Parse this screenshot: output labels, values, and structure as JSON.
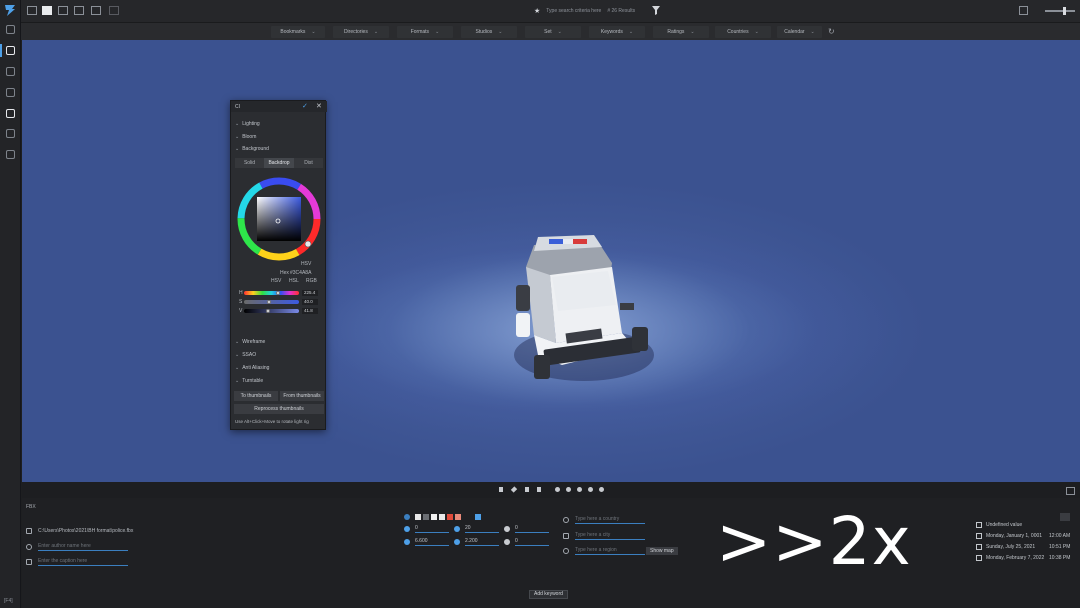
{
  "topbar": {
    "search_placeholder": "Type search criteria here",
    "result_count": "# 26 Results"
  },
  "filterbar": {
    "items": [
      "Bookmarks",
      "Directories",
      "Formats",
      "Studios",
      "Set",
      "Keywords",
      "Ratings",
      "Countries",
      "Calendar"
    ]
  },
  "panel": {
    "title": "CI",
    "sections_top": [
      "Lighting",
      "Bloom",
      "Background"
    ],
    "bg_modes": [
      "Solid",
      "Backdrop",
      "Dist"
    ],
    "active_bg_mode": "Backdrop",
    "color_mode": "HSV",
    "hex_label": "Hex",
    "hex_value": "#3C4A8A",
    "modes": [
      "HSV",
      "HSL",
      "RGB"
    ],
    "sliders": [
      {
        "label": "H",
        "value": "225.4",
        "pos": 0.63
      },
      {
        "label": "S",
        "value": "40.0",
        "pos": 0.45
      },
      {
        "label": "V",
        "value": "41.8",
        "pos": 0.43
      }
    ],
    "sections_bottom": [
      "Wireframe",
      "SSAO",
      "Anti Aliasing",
      "Turntable"
    ],
    "btn_to_thumbs": "To thumbnails",
    "btn_from_thumbs": "From thumbnails",
    "btn_reprocess": "Reprocess thumbnails",
    "hint": "Use Alt+Click+Move to rotate light rig"
  },
  "bottom": {
    "file_ext": "FBX",
    "path": "C:\\Users\\Photos\\2021\\BH format\\police.fbx",
    "author_placeholder": "Enter author name here",
    "caption_placeholder": "Enter the caption here",
    "counts": [
      {
        "a": "0",
        "b": "20",
        "c": "0"
      },
      {
        "a": "6.600",
        "b": "2.200",
        "c": "0"
      }
    ],
    "country_placeholder": "Type here a country",
    "city_placeholder": "Type here a city",
    "region_placeholder": "Type here a region",
    "show_map": "Show map",
    "speed": ">>2x",
    "dates": [
      {
        "label": "Undefined value",
        "time": ""
      },
      {
        "label": "Monday, January 1, 0001",
        "time": "12:00 AM"
      },
      {
        "label": "Sunday, July 25, 2021",
        "time": "10:51 PM"
      },
      {
        "label": "Monday, February 7, 2022",
        "time": "10:38 PM"
      }
    ],
    "add_keyword": "Add keyword"
  },
  "rail": {
    "bottom_label": "[F4]"
  },
  "colors": {
    "accent": "#4ea0e8",
    "viewport_bg": "#3c4a8a",
    "panel_bg": "#2b2d31",
    "app_bg": "#1e1f21"
  }
}
